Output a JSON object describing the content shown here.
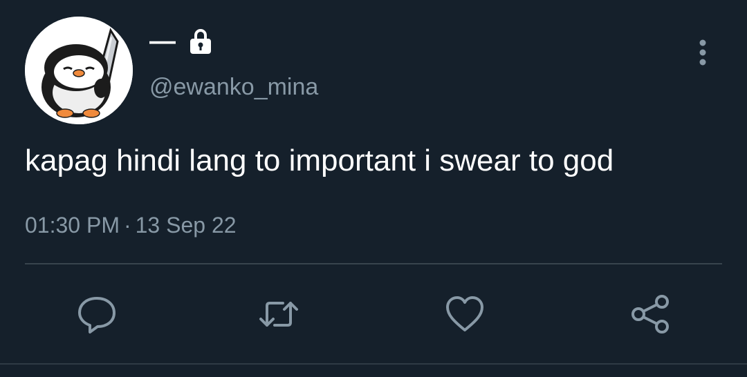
{
  "colors": {
    "background": "#15202b",
    "text_primary": "#ffffff",
    "text_secondary": "#8899a6",
    "divider": "#38444d"
  },
  "author": {
    "display_name": "—",
    "protected": true,
    "handle": "@ewanko_mina",
    "avatar_icon": "penguin-with-knife"
  },
  "tweet": {
    "text": "kapag hindi lang to important i swear to god",
    "time": "01:30 PM",
    "separator": "·",
    "date": "13 Sep 22"
  },
  "actions": [
    {
      "name": "reply",
      "icon": "speech-bubble-icon"
    },
    {
      "name": "retweet",
      "icon": "retweet-arrows-icon"
    },
    {
      "name": "like",
      "icon": "heart-icon"
    },
    {
      "name": "share",
      "icon": "share-nodes-icon"
    }
  ],
  "menu_icon": "vertical-dots-icon"
}
